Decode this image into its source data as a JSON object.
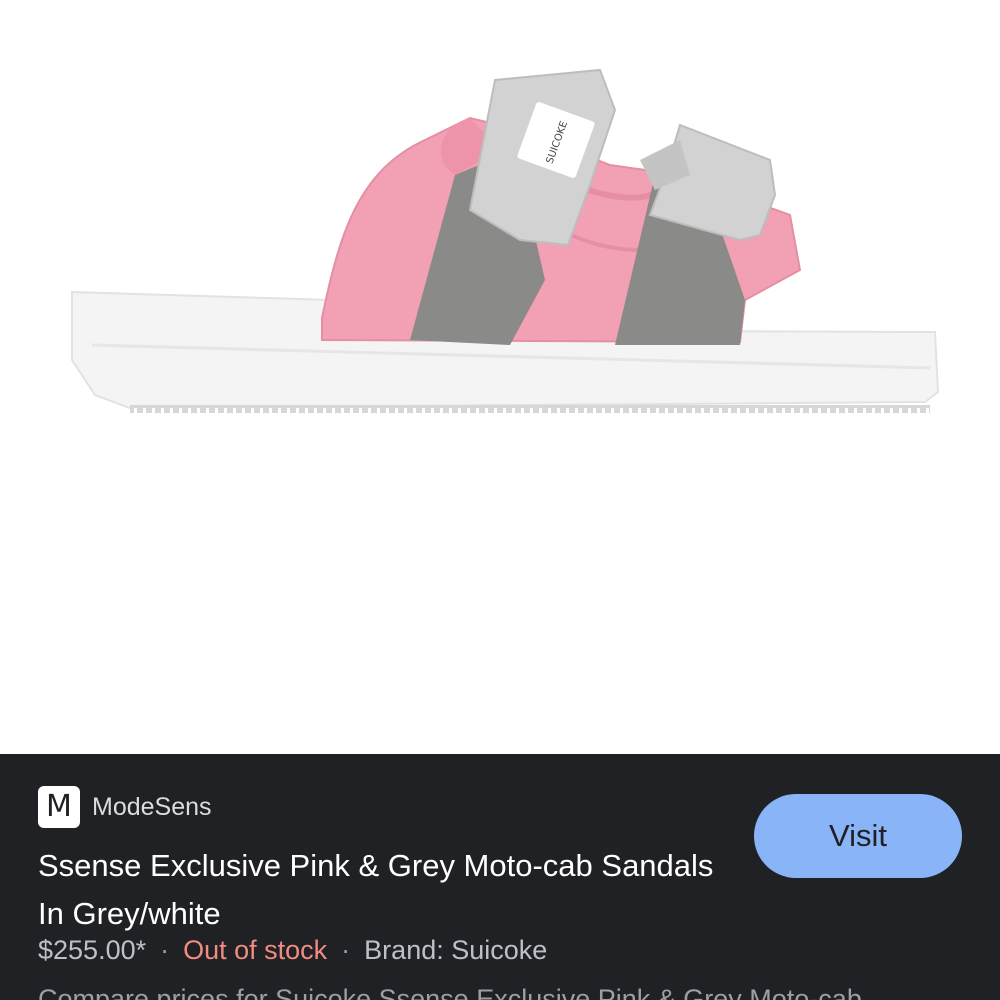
{
  "product_image": {
    "icon": "sandal-image",
    "strap_label": "SUICOKE",
    "colors": {
      "sole": "#f3f3f3",
      "upper": "#f2a0b4",
      "suede": "#8a8a88",
      "strap": "#d2d2d2"
    }
  },
  "source": {
    "logo_letter": "M",
    "name": "ModeSens"
  },
  "visit_button": {
    "label": "Visit",
    "color": "#8ab4f8"
  },
  "product": {
    "title": "Ssense Exclusive Pink & Grey Moto-cab Sandals In Grey/white",
    "price": "$255.00*",
    "separator": "·",
    "stock_status": "Out of stock",
    "brand": "Brand: Suicoke",
    "description": "Compare prices for Suicoke Ssense Exclusive Pink & Grey Moto-cab"
  },
  "theme": {
    "panel_bg": "#202124",
    "stock_color": "#f28b82"
  }
}
